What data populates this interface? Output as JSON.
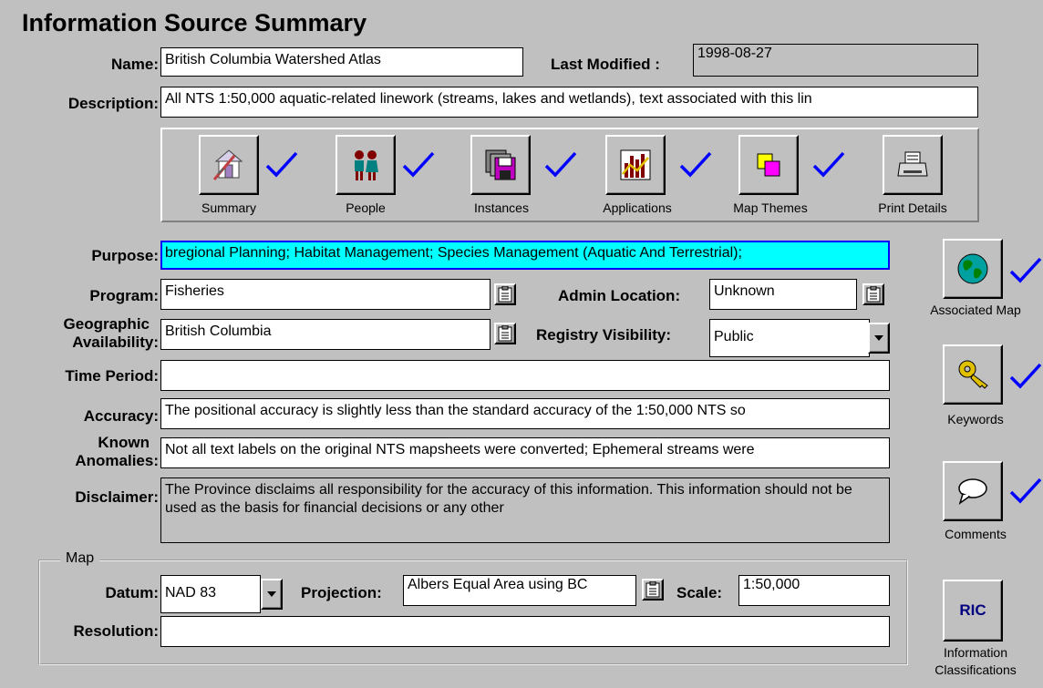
{
  "page": {
    "title": "Information Source Summary"
  },
  "labels": {
    "name": "Name:",
    "last_modified": "Last Modified :",
    "description": "Description:",
    "purpose": "Purpose:",
    "program": "Program:",
    "admin_location": "Admin Location:",
    "geographic": "Geographic",
    "availability": "Availability:",
    "registry_visibility": "Registry Visibility:",
    "time_period": "Time Period:",
    "accuracy": "Accuracy:",
    "known": "Known",
    "anomalies": "Anomalies:",
    "disclaimer": "Disclaimer:"
  },
  "fields": {
    "name": "British Columbia Watershed Atlas",
    "last_modified": "1998-08-27",
    "description": "All NTS 1:50,000 aquatic-related linework (streams, lakes and wetlands), text associated with this lin",
    "purpose": "bregional Planning; Habitat Management; Species Management (Aquatic And Terrestrial);",
    "program": "Fisheries",
    "admin_location": "Unknown",
    "geographic_availability": "British Columbia",
    "registry_visibility": "Public",
    "time_period": "",
    "accuracy": "The positional accuracy is slightly less than the standard accuracy of the 1:50,000 NTS so",
    "known_anomalies": "Not all text labels on the original NTS mapsheets were converted; Ephemeral streams were",
    "disclaimer": "The Province disclaims all responsibility for the accuracy of this information. This information should not be used as the basis for financial decisions or any other"
  },
  "toolbar": {
    "summary": "Summary",
    "people": "People",
    "instances": "Instances",
    "applications": "Applications",
    "map_themes": "Map Themes",
    "print_details": "Print Details"
  },
  "side": {
    "associated_map": "Associated Map",
    "keywords": "Keywords",
    "comments": "Comments",
    "ric_button": "RIC",
    "info_class_line1": "Information",
    "info_class_line2": "Classifications"
  },
  "map_group": {
    "legend": "Map",
    "datum_label": "Datum:",
    "datum": "NAD 83",
    "projection_label": "Projection:",
    "projection": "Albers Equal Area using BC",
    "scale_label": "Scale:",
    "scale": "1:50,000",
    "resolution_label": "Resolution:",
    "resolution": ""
  },
  "colors": {
    "check": "#0000ff",
    "background": "#c0c0c0",
    "highlight": "#00ffff"
  }
}
